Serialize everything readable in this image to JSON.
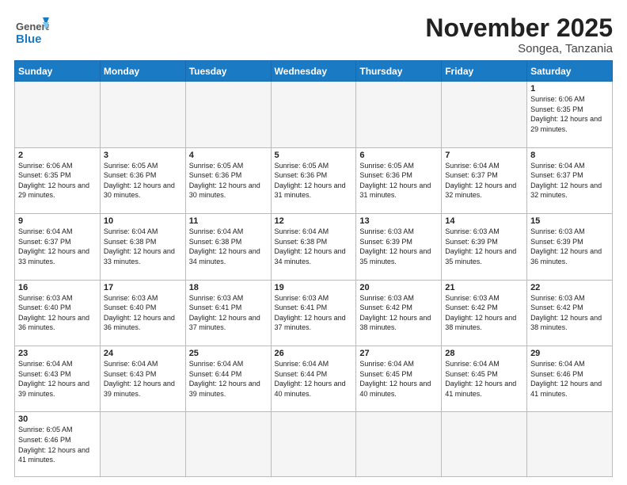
{
  "header": {
    "logo_general": "General",
    "logo_blue": "Blue",
    "month_title": "November 2025",
    "location": "Songea, Tanzania"
  },
  "weekdays": [
    "Sunday",
    "Monday",
    "Tuesday",
    "Wednesday",
    "Thursday",
    "Friday",
    "Saturday"
  ],
  "days": [
    {
      "date": "",
      "info": ""
    },
    {
      "date": "",
      "info": ""
    },
    {
      "date": "",
      "info": ""
    },
    {
      "date": "",
      "info": ""
    },
    {
      "date": "",
      "info": ""
    },
    {
      "date": "",
      "info": ""
    },
    {
      "date": "1",
      "info": "Sunrise: 6:06 AM\nSunset: 6:35 PM\nDaylight: 12 hours and 29 minutes."
    },
    {
      "date": "2",
      "info": "Sunrise: 6:06 AM\nSunset: 6:35 PM\nDaylight: 12 hours and 29 minutes."
    },
    {
      "date": "3",
      "info": "Sunrise: 6:05 AM\nSunset: 6:36 PM\nDaylight: 12 hours and 30 minutes."
    },
    {
      "date": "4",
      "info": "Sunrise: 6:05 AM\nSunset: 6:36 PM\nDaylight: 12 hours and 30 minutes."
    },
    {
      "date": "5",
      "info": "Sunrise: 6:05 AM\nSunset: 6:36 PM\nDaylight: 12 hours and 31 minutes."
    },
    {
      "date": "6",
      "info": "Sunrise: 6:05 AM\nSunset: 6:36 PM\nDaylight: 12 hours and 31 minutes."
    },
    {
      "date": "7",
      "info": "Sunrise: 6:04 AM\nSunset: 6:37 PM\nDaylight: 12 hours and 32 minutes."
    },
    {
      "date": "8",
      "info": "Sunrise: 6:04 AM\nSunset: 6:37 PM\nDaylight: 12 hours and 32 minutes."
    },
    {
      "date": "9",
      "info": "Sunrise: 6:04 AM\nSunset: 6:37 PM\nDaylight: 12 hours and 33 minutes."
    },
    {
      "date": "10",
      "info": "Sunrise: 6:04 AM\nSunset: 6:38 PM\nDaylight: 12 hours and 33 minutes."
    },
    {
      "date": "11",
      "info": "Sunrise: 6:04 AM\nSunset: 6:38 PM\nDaylight: 12 hours and 34 minutes."
    },
    {
      "date": "12",
      "info": "Sunrise: 6:04 AM\nSunset: 6:38 PM\nDaylight: 12 hours and 34 minutes."
    },
    {
      "date": "13",
      "info": "Sunrise: 6:03 AM\nSunset: 6:39 PM\nDaylight: 12 hours and 35 minutes."
    },
    {
      "date": "14",
      "info": "Sunrise: 6:03 AM\nSunset: 6:39 PM\nDaylight: 12 hours and 35 minutes."
    },
    {
      "date": "15",
      "info": "Sunrise: 6:03 AM\nSunset: 6:39 PM\nDaylight: 12 hours and 36 minutes."
    },
    {
      "date": "16",
      "info": "Sunrise: 6:03 AM\nSunset: 6:40 PM\nDaylight: 12 hours and 36 minutes."
    },
    {
      "date": "17",
      "info": "Sunrise: 6:03 AM\nSunset: 6:40 PM\nDaylight: 12 hours and 36 minutes."
    },
    {
      "date": "18",
      "info": "Sunrise: 6:03 AM\nSunset: 6:41 PM\nDaylight: 12 hours and 37 minutes."
    },
    {
      "date": "19",
      "info": "Sunrise: 6:03 AM\nSunset: 6:41 PM\nDaylight: 12 hours and 37 minutes."
    },
    {
      "date": "20",
      "info": "Sunrise: 6:03 AM\nSunset: 6:42 PM\nDaylight: 12 hours and 38 minutes."
    },
    {
      "date": "21",
      "info": "Sunrise: 6:03 AM\nSunset: 6:42 PM\nDaylight: 12 hours and 38 minutes."
    },
    {
      "date": "22",
      "info": "Sunrise: 6:03 AM\nSunset: 6:42 PM\nDaylight: 12 hours and 38 minutes."
    },
    {
      "date": "23",
      "info": "Sunrise: 6:04 AM\nSunset: 6:43 PM\nDaylight: 12 hours and 39 minutes."
    },
    {
      "date": "24",
      "info": "Sunrise: 6:04 AM\nSunset: 6:43 PM\nDaylight: 12 hours and 39 minutes."
    },
    {
      "date": "25",
      "info": "Sunrise: 6:04 AM\nSunset: 6:44 PM\nDaylight: 12 hours and 39 minutes."
    },
    {
      "date": "26",
      "info": "Sunrise: 6:04 AM\nSunset: 6:44 PM\nDaylight: 12 hours and 40 minutes."
    },
    {
      "date": "27",
      "info": "Sunrise: 6:04 AM\nSunset: 6:45 PM\nDaylight: 12 hours and 40 minutes."
    },
    {
      "date": "28",
      "info": "Sunrise: 6:04 AM\nSunset: 6:45 PM\nDaylight: 12 hours and 41 minutes."
    },
    {
      "date": "29",
      "info": "Sunrise: 6:04 AM\nSunset: 6:46 PM\nDaylight: 12 hours and 41 minutes."
    },
    {
      "date": "30",
      "info": "Sunrise: 6:05 AM\nSunset: 6:46 PM\nDaylight: 12 hours and 41 minutes."
    },
    {
      "date": "",
      "info": ""
    },
    {
      "date": "",
      "info": ""
    },
    {
      "date": "",
      "info": ""
    },
    {
      "date": "",
      "info": ""
    },
    {
      "date": "",
      "info": ""
    },
    {
      "date": "",
      "info": ""
    }
  ]
}
